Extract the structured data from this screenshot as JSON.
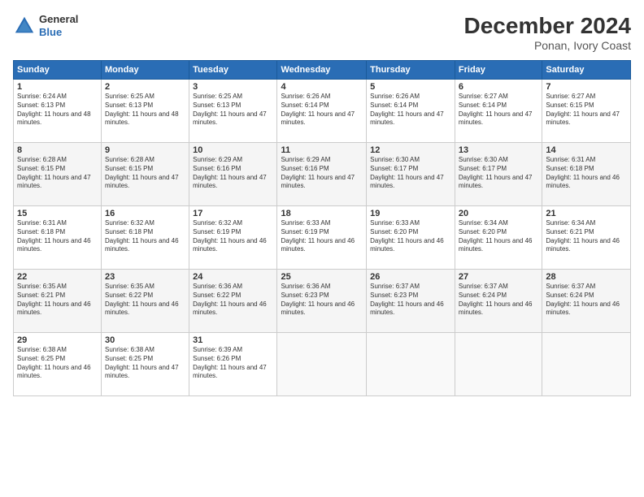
{
  "header": {
    "logo_general": "General",
    "logo_blue": "Blue",
    "month_title": "December 2024",
    "location": "Ponan, Ivory Coast"
  },
  "weekdays": [
    "Sunday",
    "Monday",
    "Tuesday",
    "Wednesday",
    "Thursday",
    "Friday",
    "Saturday"
  ],
  "weeks": [
    [
      {
        "day": "1",
        "sunrise": "6:24 AM",
        "sunset": "6:13 PM",
        "daylight": "11 hours and 48 minutes."
      },
      {
        "day": "2",
        "sunrise": "6:25 AM",
        "sunset": "6:13 PM",
        "daylight": "11 hours and 48 minutes."
      },
      {
        "day": "3",
        "sunrise": "6:25 AM",
        "sunset": "6:13 PM",
        "daylight": "11 hours and 47 minutes."
      },
      {
        "day": "4",
        "sunrise": "6:26 AM",
        "sunset": "6:14 PM",
        "daylight": "11 hours and 47 minutes."
      },
      {
        "day": "5",
        "sunrise": "6:26 AM",
        "sunset": "6:14 PM",
        "daylight": "11 hours and 47 minutes."
      },
      {
        "day": "6",
        "sunrise": "6:27 AM",
        "sunset": "6:14 PM",
        "daylight": "11 hours and 47 minutes."
      },
      {
        "day": "7",
        "sunrise": "6:27 AM",
        "sunset": "6:15 PM",
        "daylight": "11 hours and 47 minutes."
      }
    ],
    [
      {
        "day": "8",
        "sunrise": "6:28 AM",
        "sunset": "6:15 PM",
        "daylight": "11 hours and 47 minutes."
      },
      {
        "day": "9",
        "sunrise": "6:28 AM",
        "sunset": "6:15 PM",
        "daylight": "11 hours and 47 minutes."
      },
      {
        "day": "10",
        "sunrise": "6:29 AM",
        "sunset": "6:16 PM",
        "daylight": "11 hours and 47 minutes."
      },
      {
        "day": "11",
        "sunrise": "6:29 AM",
        "sunset": "6:16 PM",
        "daylight": "11 hours and 47 minutes."
      },
      {
        "day": "12",
        "sunrise": "6:30 AM",
        "sunset": "6:17 PM",
        "daylight": "11 hours and 47 minutes."
      },
      {
        "day": "13",
        "sunrise": "6:30 AM",
        "sunset": "6:17 PM",
        "daylight": "11 hours and 47 minutes."
      },
      {
        "day": "14",
        "sunrise": "6:31 AM",
        "sunset": "6:18 PM",
        "daylight": "11 hours and 46 minutes."
      }
    ],
    [
      {
        "day": "15",
        "sunrise": "6:31 AM",
        "sunset": "6:18 PM",
        "daylight": "11 hours and 46 minutes."
      },
      {
        "day": "16",
        "sunrise": "6:32 AM",
        "sunset": "6:18 PM",
        "daylight": "11 hours and 46 minutes."
      },
      {
        "day": "17",
        "sunrise": "6:32 AM",
        "sunset": "6:19 PM",
        "daylight": "11 hours and 46 minutes."
      },
      {
        "day": "18",
        "sunrise": "6:33 AM",
        "sunset": "6:19 PM",
        "daylight": "11 hours and 46 minutes."
      },
      {
        "day": "19",
        "sunrise": "6:33 AM",
        "sunset": "6:20 PM",
        "daylight": "11 hours and 46 minutes."
      },
      {
        "day": "20",
        "sunrise": "6:34 AM",
        "sunset": "6:20 PM",
        "daylight": "11 hours and 46 minutes."
      },
      {
        "day": "21",
        "sunrise": "6:34 AM",
        "sunset": "6:21 PM",
        "daylight": "11 hours and 46 minutes."
      }
    ],
    [
      {
        "day": "22",
        "sunrise": "6:35 AM",
        "sunset": "6:21 PM",
        "daylight": "11 hours and 46 minutes."
      },
      {
        "day": "23",
        "sunrise": "6:35 AM",
        "sunset": "6:22 PM",
        "daylight": "11 hours and 46 minutes."
      },
      {
        "day": "24",
        "sunrise": "6:36 AM",
        "sunset": "6:22 PM",
        "daylight": "11 hours and 46 minutes."
      },
      {
        "day": "25",
        "sunrise": "6:36 AM",
        "sunset": "6:23 PM",
        "daylight": "11 hours and 46 minutes."
      },
      {
        "day": "26",
        "sunrise": "6:37 AM",
        "sunset": "6:23 PM",
        "daylight": "11 hours and 46 minutes."
      },
      {
        "day": "27",
        "sunrise": "6:37 AM",
        "sunset": "6:24 PM",
        "daylight": "11 hours and 46 minutes."
      },
      {
        "day": "28",
        "sunrise": "6:37 AM",
        "sunset": "6:24 PM",
        "daylight": "11 hours and 46 minutes."
      }
    ],
    [
      {
        "day": "29",
        "sunrise": "6:38 AM",
        "sunset": "6:25 PM",
        "daylight": "11 hours and 46 minutes."
      },
      {
        "day": "30",
        "sunrise": "6:38 AM",
        "sunset": "6:25 PM",
        "daylight": "11 hours and 47 minutes."
      },
      {
        "day": "31",
        "sunrise": "6:39 AM",
        "sunset": "6:26 PM",
        "daylight": "11 hours and 47 minutes."
      },
      null,
      null,
      null,
      null
    ]
  ],
  "labels": {
    "sunrise": "Sunrise:",
    "sunset": "Sunset:",
    "daylight": "Daylight:"
  }
}
